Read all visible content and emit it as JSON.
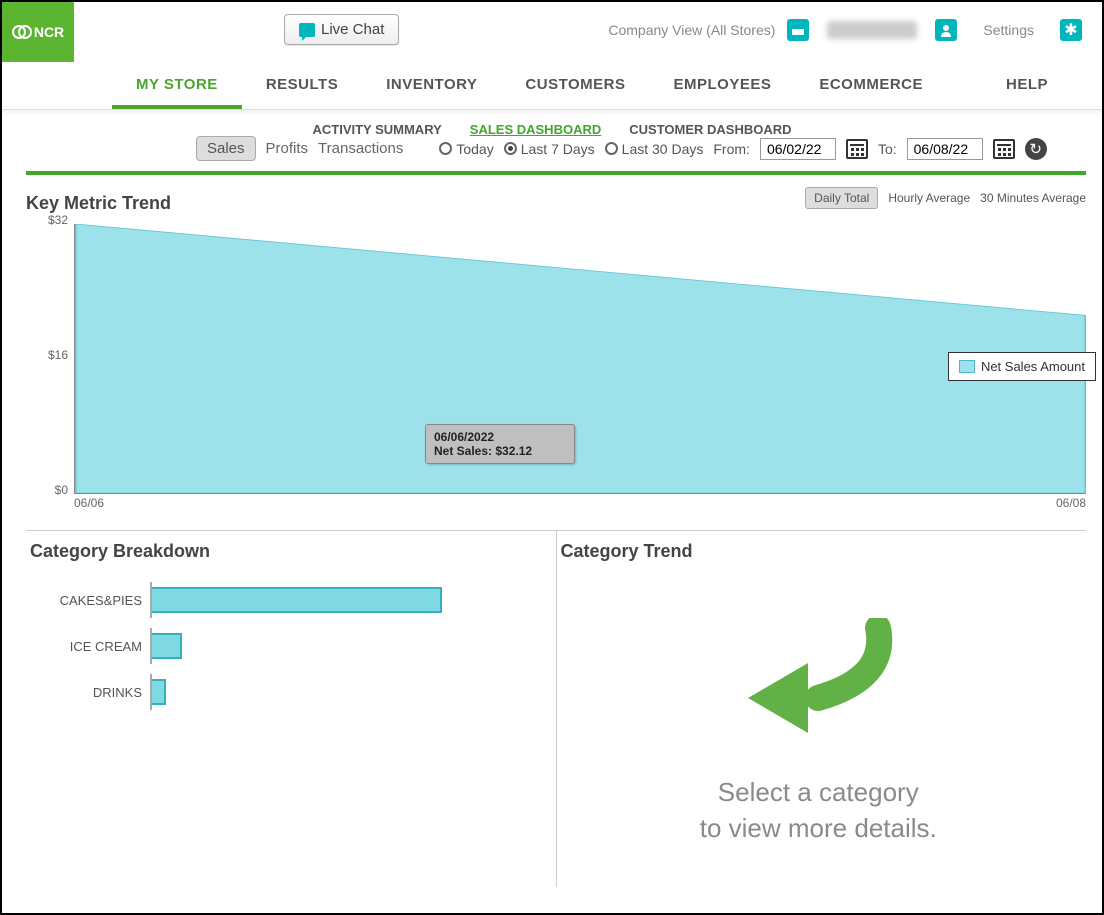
{
  "header": {
    "brand": "NCR",
    "live_chat": "Live Chat",
    "company_view": "Company View (All Stores)",
    "settings": "Settings"
  },
  "main_nav": [
    "MY STORE",
    "RESULTS",
    "INVENTORY",
    "CUSTOMERS",
    "EMPLOYEES",
    "ECOMMERCE",
    "HELP"
  ],
  "main_nav_active": 0,
  "sub_nav": [
    "ACTIVITY SUMMARY",
    "SALES DASHBOARD",
    "CUSTOMER DASHBOARD"
  ],
  "sub_nav_active": 1,
  "filters": {
    "tabs": [
      "Sales",
      "Profits",
      "Transactions"
    ],
    "tabs_active": 0,
    "ranges": [
      "Today",
      "Last 7 Days",
      "Last 30 Days"
    ],
    "ranges_selected": 1,
    "from_label": "From:",
    "to_label": "To:",
    "from": "06/02/22",
    "to": "06/08/22"
  },
  "metric": {
    "title": "Key Metric Trend",
    "agg_options": [
      "Daily Total",
      "Hourly Average",
      "30 Minutes Average"
    ],
    "agg_selected": 0,
    "legend": "Net Sales Amount",
    "tooltip_date": "06/06/2022",
    "tooltip_value": "Net Sales: $32.12"
  },
  "breakdown": {
    "title": "Category Breakdown"
  },
  "trend": {
    "title": "Category Trend",
    "empty_line1": "Select a category",
    "empty_line2": "to view more details."
  },
  "chart_data": [
    {
      "type": "area",
      "title": "Key Metric Trend",
      "series": [
        {
          "name": "Net Sales Amount",
          "values": [
            32,
            21
          ]
        }
      ],
      "x": [
        "06/06",
        "06/08"
      ],
      "ylabel": "",
      "xlabel": "",
      "yticks": [
        "$0",
        "$16",
        "$32"
      ],
      "ylim": [
        0,
        32
      ]
    },
    {
      "type": "bar",
      "orientation": "horizontal",
      "title": "Category Breakdown",
      "categories": [
        "CAKES&PIES",
        "ICE CREAM",
        "DRINKS"
      ],
      "values": [
        290,
        30,
        14
      ]
    }
  ]
}
